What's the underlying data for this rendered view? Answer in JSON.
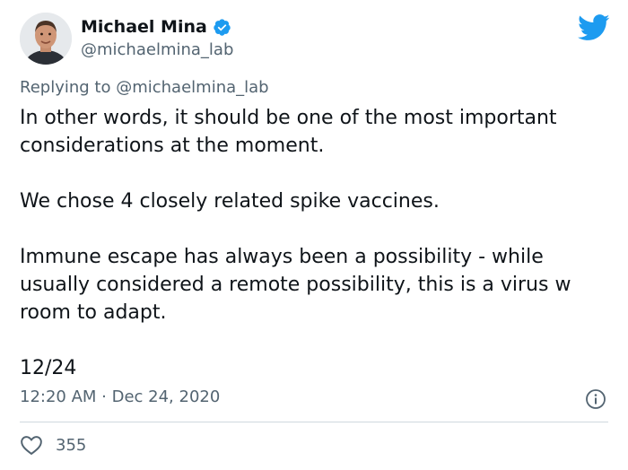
{
  "author": {
    "display_name": "Michael Mina",
    "handle": "@michaelmina_lab",
    "verified": true,
    "avatar_icon": "profile-photo"
  },
  "reply": {
    "prefix": "Replying to",
    "handle": "@michaelmina_lab"
  },
  "tweet": {
    "paragraphs": [
      "In other words, it should be one of the most important considerations at the moment.",
      "We chose 4 closely related spike vaccines.",
      "Immune escape has always been a possibility - while usually considered a remote possibility, this is a virus w room to adapt.",
      "12/24"
    ],
    "timestamp": "12:20 AM · Dec 24, 2020"
  },
  "engagement": {
    "likes": "355",
    "like_icon": "heart-icon"
  },
  "icons": {
    "brand": "twitter-bird-icon",
    "info": "info-icon",
    "verified": "verified-badge-icon"
  },
  "colors": {
    "brand_blue": "#1d9bf0",
    "text_primary": "#0f1419",
    "text_secondary": "#536471",
    "divider": "#cfd9de"
  }
}
